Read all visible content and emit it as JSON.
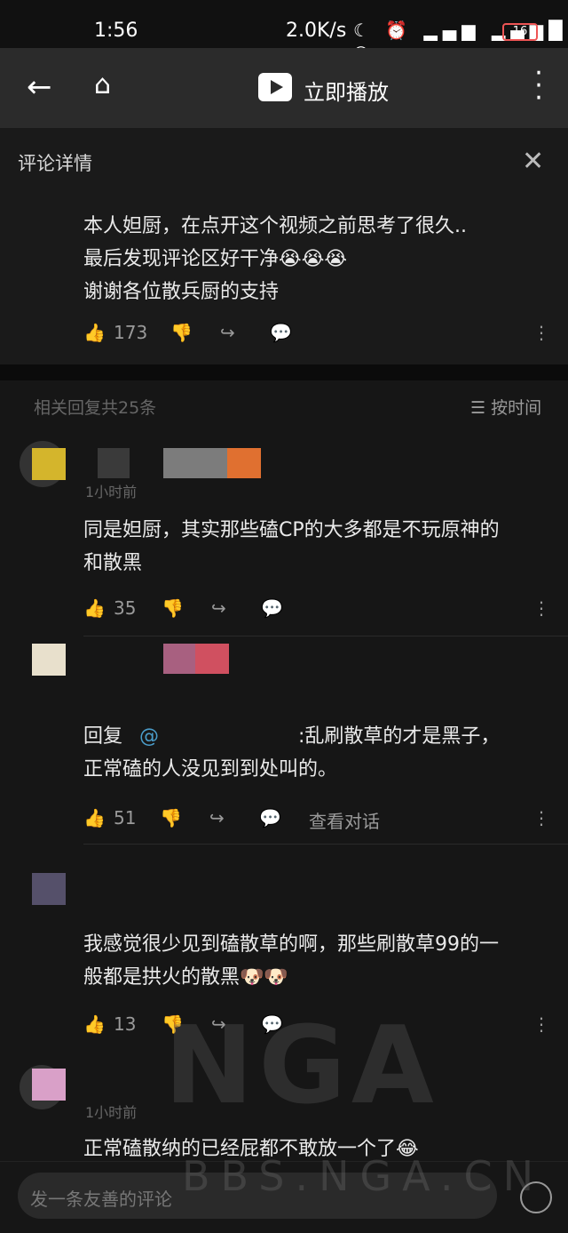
{
  "status_bar": {
    "time": "1:56",
    "network_speed": "2.0K/s",
    "battery": "16"
  },
  "top_bar": {
    "title": "立即播放"
  },
  "panel": {
    "title": "评论详情"
  },
  "main_comment": {
    "lines": [
      "本人妲厨，在点开这个视频之前思考了很久..",
      "最后发现评论区好干净😭😭😭",
      "谢谢各位散兵厨的支持"
    ],
    "likes": "173"
  },
  "replies_header": {
    "count_text": "相关回复共25条",
    "sort_label": "按时间"
  },
  "comments": [
    {
      "time": "1小时前",
      "text_line1": "同是妲厨，其实那些磕CP的大多都是不玩原神的",
      "text_line2": "和散黑",
      "likes": "35",
      "colors": [
        "#d4b52c",
        "#3a3a3a",
        "#7c7c7c",
        "#e07030"
      ]
    },
    {
      "reply_prefix": "回复",
      "mention": "@",
      "text_line1_suffix": ":乱刷散草的才是黑子，",
      "text_line2": "正常磕的人没见到到处叫的。",
      "likes": "51",
      "view_conversation": "查看对话",
      "colors": [
        "#e8e0cc",
        "#a86080",
        "#d05060"
      ]
    },
    {
      "text_line1": "我感觉很少见到磕散草的啊，那些刷散草99的一",
      "text_line2": "般都是拱火的散黑🐶🐶",
      "likes": "13",
      "colors": [
        "#55506a"
      ]
    },
    {
      "time": "1小时前",
      "text_line1": "正常磕散纳的已经屁都不敢放一个了😂",
      "colors": [
        "#d9a0c8"
      ]
    }
  ],
  "input": {
    "placeholder": "发一条友善的评论"
  },
  "watermark": {
    "text": "NGA",
    "url_text": "BBS.NGA.CN"
  }
}
